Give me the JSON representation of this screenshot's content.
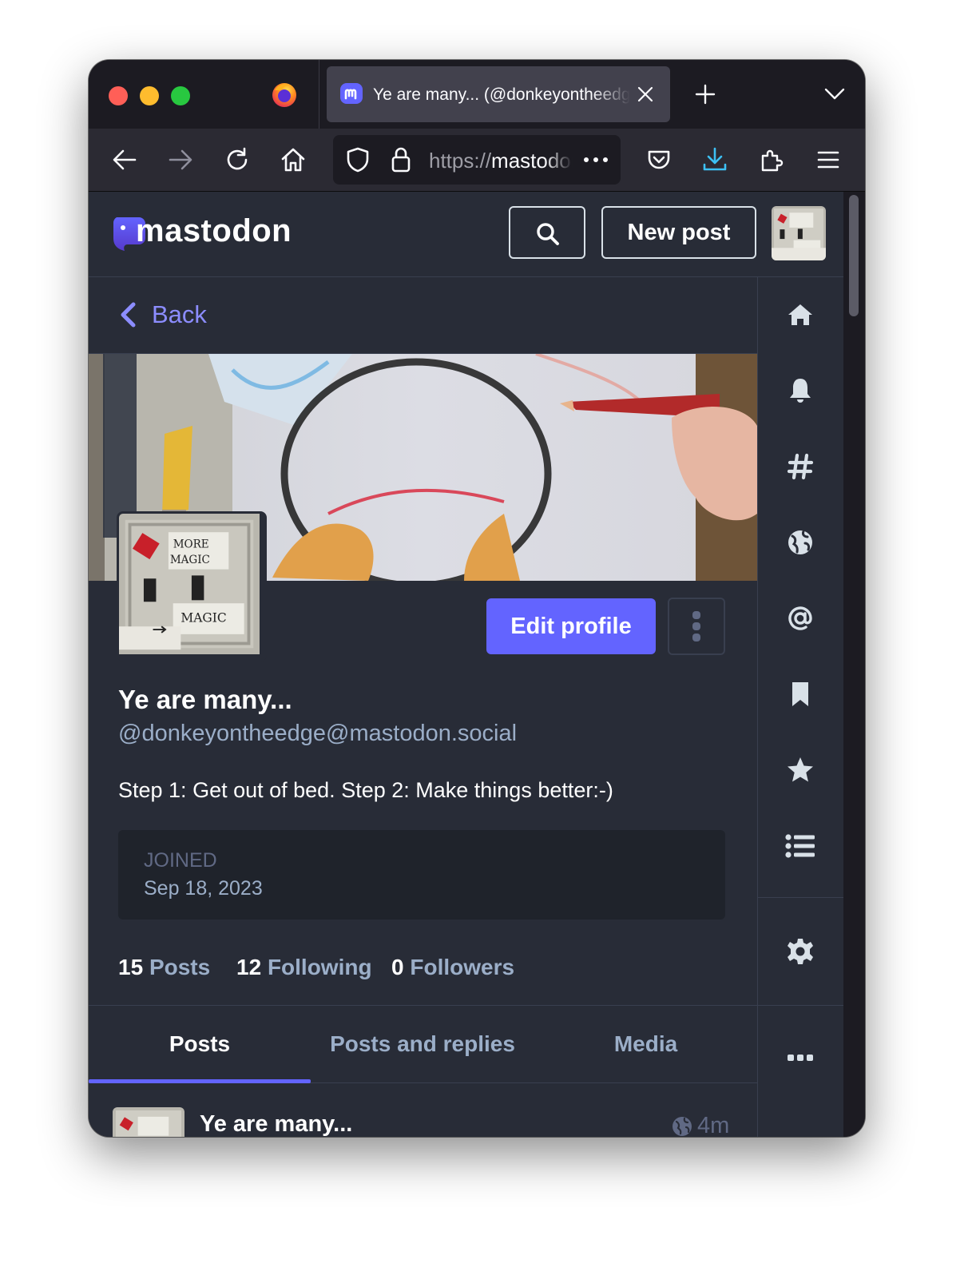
{
  "browser": {
    "tab": {
      "title": "Ye are many... (@donkeyontheedge@mastodon.social)"
    },
    "url": {
      "scheme": "https://",
      "rest": "mastodon.social/@donkeyontheedge"
    }
  },
  "header": {
    "logo_text": "mastodon",
    "new_post_label": "New post"
  },
  "column": {
    "back_label": "Back"
  },
  "profile": {
    "display_name": "Ye are many...",
    "acct": "@donkeyontheedge@mastodon.social",
    "bio": "Step 1: Get out of bed. Step 2: Make things better:-)",
    "edit_label": "Edit profile",
    "joined_label": "JOINED",
    "joined_date": "Sep 18, 2023",
    "counts": {
      "posts_value": "15",
      "posts_label": "Posts",
      "following_value": "12",
      "following_label": "Following",
      "followers_value": "0",
      "followers_label": "Followers"
    },
    "tabs": [
      {
        "label": "Posts"
      },
      {
        "label": "Posts and replies"
      },
      {
        "label": "Media"
      }
    ],
    "avatar_text": {
      "top": "MORE MAGIC",
      "bottom": "MAGIC"
    }
  },
  "status": {
    "author": "Ye are many...",
    "time": "4m"
  },
  "icons": {
    "firefox": "firefox-icon",
    "favicon": "mastodon-favicon",
    "nav": [
      "home-icon",
      "bell-icon",
      "hashtag-icon",
      "globe-icon",
      "at-icon",
      "bookmark-icon",
      "star-icon",
      "list-icon",
      "gear-icon",
      "ellipsis-icon"
    ]
  },
  "colors": {
    "accent": "#6364ff",
    "link": "#8c8dff",
    "background": "#282c37",
    "secondary_text": "#9baec8"
  }
}
